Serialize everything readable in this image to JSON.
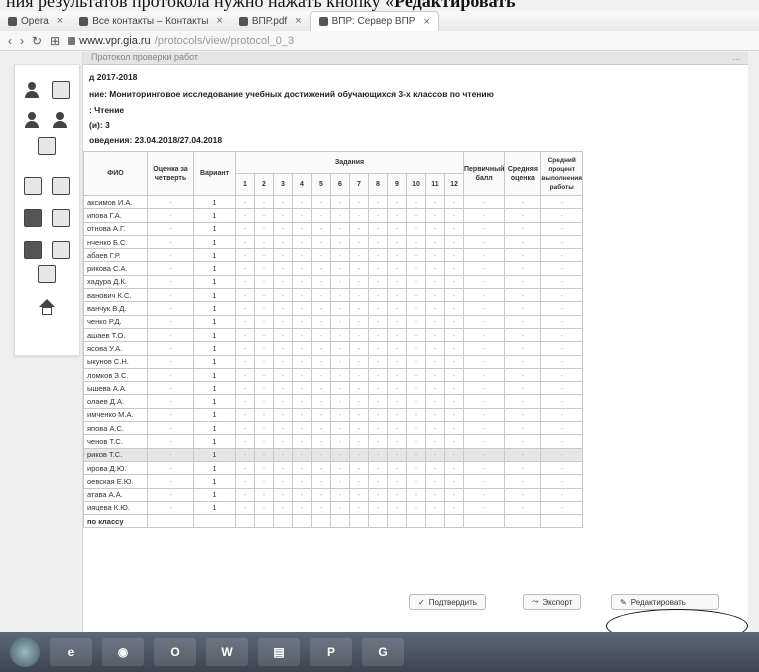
{
  "caption": {
    "prefix": "ния результатов протокола нужно нажать кнопку «",
    "bold": "Редактировать"
  },
  "browser": {
    "tabs": [
      {
        "label": "Opera",
        "icon": "opera-icon"
      },
      {
        "label": "Все контакты – Контакты",
        "icon": "contacts-icon"
      },
      {
        "label": "ВПР.pdf",
        "icon": "pdf-icon"
      },
      {
        "label": "ВПР: Сервер ВПР",
        "icon": "page-icon",
        "active": true
      }
    ],
    "url_host": "www.vpr.gia.ru",
    "url_path": "/protocols/view/protocol_0_3"
  },
  "page": {
    "header_title": "Протокол проверки работ",
    "header_right": "...",
    "year": "д 2017-2018",
    "event": "ние: Мониторинговое исследование учебных достижений обучающихся 3-х классов по чтению",
    "subject": ": Чтение",
    "grade": "(и): 3",
    "dates": "оведения: 23.04.2018/27.04.2018"
  },
  "table": {
    "headers": {
      "fio": "ФИО",
      "mark": "Оценка за четверть",
      "variant": "Вариант",
      "tasks": "Задания",
      "score": "Первичный балл",
      "avg": "Средняя оценка",
      "percent": "Средний процент выполнения работы"
    },
    "task_numbers": [
      "1",
      "2",
      "3",
      "4",
      "5",
      "6",
      "7",
      "8",
      "9",
      "10",
      "11",
      "12"
    ],
    "rows": [
      {
        "fio": "аксимов И.А."
      },
      {
        "fio": "ипова Г.А."
      },
      {
        "fio": "отнова А.Г."
      },
      {
        "fio": "нченко Б.С."
      },
      {
        "fio": "абаев Г.Р."
      },
      {
        "fio": "рикова С.А."
      },
      {
        "fio": "хадура Д.К."
      },
      {
        "fio": "ванович К.С."
      },
      {
        "fio": "ванчук В.Д."
      },
      {
        "fio": "ченко Р.Д."
      },
      {
        "fio": "ашаев Т.О."
      },
      {
        "fio": "ясова У.А."
      },
      {
        "fio": "ыкунов С.Н."
      },
      {
        "fio": "ломков З.С."
      },
      {
        "fio": "ышева А.А."
      },
      {
        "fio": "олаев Д.А."
      },
      {
        "fio": "имченко М.А."
      },
      {
        "fio": "япова А.С."
      },
      {
        "fio": "ченов Т.С."
      },
      {
        "fio": "риков Т.С.",
        "highlight": true
      },
      {
        "fio": "ирова Д.Ю."
      },
      {
        "fio": "оевская Е.Ю."
      },
      {
        "fio": "атава А.А."
      },
      {
        "fio": "ияцева К.Ю."
      }
    ],
    "cell_mark": "-",
    "cell_variant": "1",
    "cell_task": "-",
    "total_label": "по классу"
  },
  "buttons": {
    "confirm": "Подтвердить",
    "export": "Экспорт",
    "edit": "Редактировать"
  },
  "taskbar": {
    "items": [
      "start",
      "ie",
      "chrome",
      "opera",
      "word",
      "files",
      "project",
      "g"
    ]
  }
}
